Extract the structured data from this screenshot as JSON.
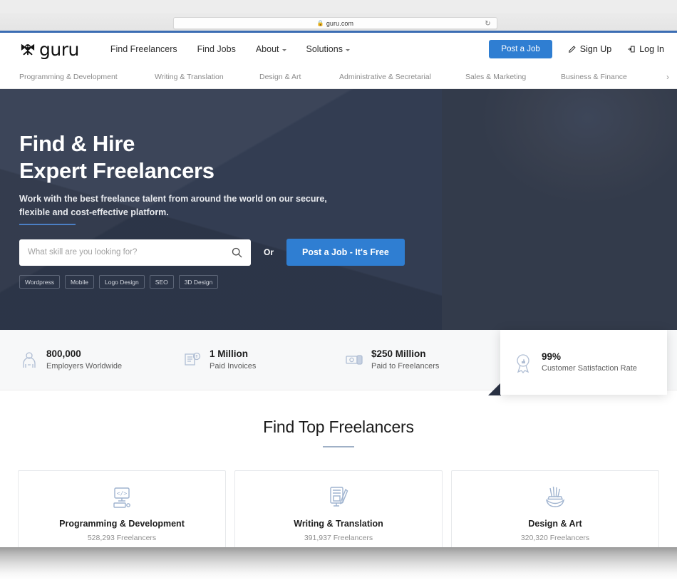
{
  "browser": {
    "url": "guru.com",
    "lock_icon": "lock-icon",
    "reload_icon": "reload-icon"
  },
  "header": {
    "logo_text": "guru",
    "logo_icon": "guru-logo-icon",
    "nav": [
      {
        "label": "Find Freelancers",
        "has_caret": false
      },
      {
        "label": "Find Jobs",
        "has_caret": false
      },
      {
        "label": "About",
        "has_caret": true
      },
      {
        "label": "Solutions",
        "has_caret": true
      }
    ],
    "post_job_label": "Post a Job",
    "sign_up_label": "Sign Up",
    "log_in_label": "Log In",
    "sign_up_icon": "pencil-icon",
    "log_in_icon": "login-arrow-icon",
    "accent_color": "#2f7ed2"
  },
  "category_nav": {
    "items": [
      "Programming & Development",
      "Writing & Translation",
      "Design & Art",
      "Administrative & Secretarial",
      "Sales & Marketing",
      "Business & Finance"
    ],
    "next_arrow_icon": "chevron-right-icon",
    "next_arrow_glyph": "›"
  },
  "hero": {
    "title_line1": "Find & Hire",
    "title_line2": "Expert Freelancers",
    "subtitle_line1": "Work with the best freelance talent from around the world on our secure,",
    "subtitle_line2": "flexible and cost-effective platform.",
    "search_placeholder": "What skill are you looking for?",
    "search_value": "",
    "search_icon": "search-icon",
    "or_label": "Or",
    "post_job_label": "Post a Job - It's Free",
    "tags": [
      "Wordpress",
      "Mobile",
      "Logo Design",
      "SEO",
      "3D Design"
    ],
    "background_color": "#333d52",
    "photo_alt": "smiling-man-with-glasses-photo"
  },
  "stats": [
    {
      "icon": "employers-icon",
      "value": "800,000",
      "label": "Employers Worldwide"
    },
    {
      "icon": "invoice-icon",
      "value": "1 Million",
      "label": "Paid Invoices"
    },
    {
      "icon": "money-icon",
      "value": "$250 Million",
      "label": "Paid to Freelancers"
    }
  ],
  "stat_card": {
    "icon": "ribbon-badge-icon",
    "value": "99%",
    "label": "Customer Satisfaction Rate"
  },
  "section": {
    "title": "Find Top Freelancers",
    "cards": [
      {
        "icon": "code-monitor-icon",
        "title": "Programming & Development",
        "count": "528,293 Freelancers"
      },
      {
        "icon": "writing-desk-icon",
        "title": "Writing & Translation",
        "count": "391,937 Freelancers"
      },
      {
        "icon": "paint-brushes-icon",
        "title": "Design & Art",
        "count": "320,320 Freelancers"
      }
    ]
  }
}
